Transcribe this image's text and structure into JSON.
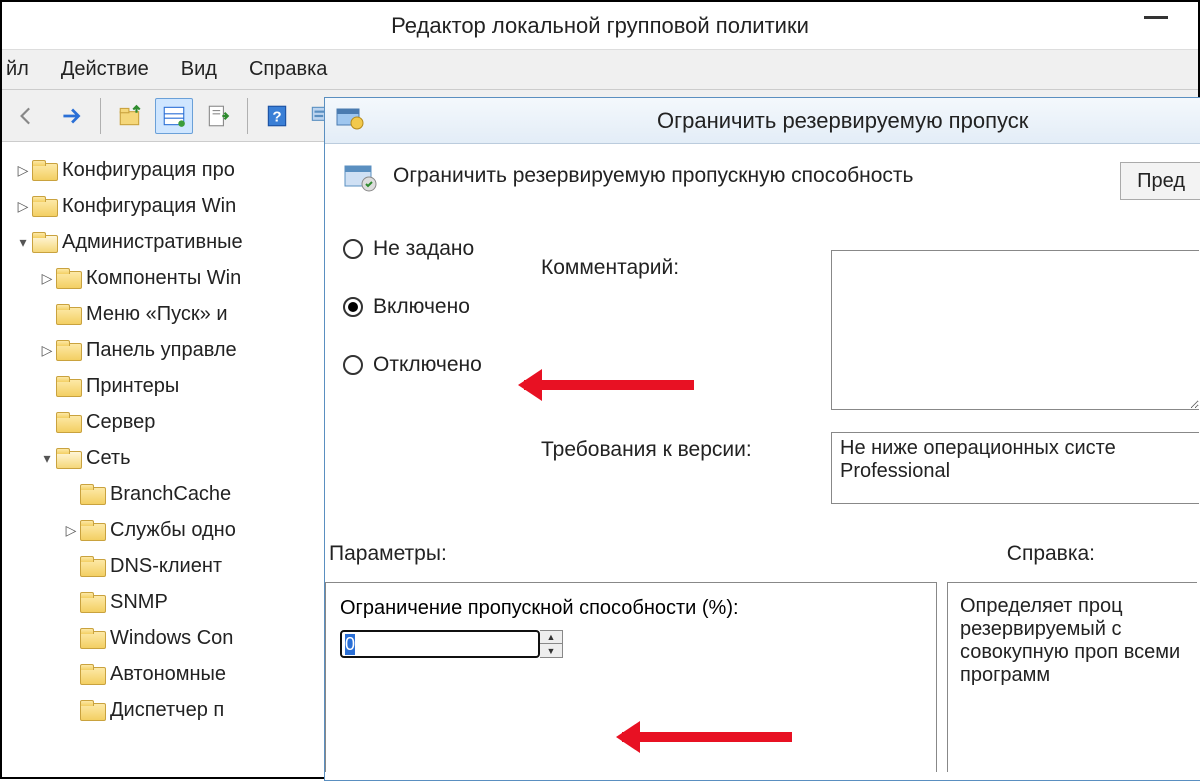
{
  "window": {
    "title": "Редактор локальной групповой политики"
  },
  "menu": {
    "file": "йл",
    "action": "Действие",
    "view": "Вид",
    "help": "Справка"
  },
  "tree": {
    "items": [
      {
        "indent": 1,
        "caret": "right",
        "label": "Конфигурация про"
      },
      {
        "indent": 1,
        "caret": "right",
        "label": "Конфигурация Win"
      },
      {
        "indent": 1,
        "caret": "down",
        "label": "Административные"
      },
      {
        "indent": 2,
        "caret": "right",
        "label": "Компоненты Win"
      },
      {
        "indent": 2,
        "caret": "",
        "label": "Меню «Пуск» и"
      },
      {
        "indent": 2,
        "caret": "right",
        "label": "Панель управле"
      },
      {
        "indent": 2,
        "caret": "",
        "label": "Принтеры"
      },
      {
        "indent": 2,
        "caret": "",
        "label": "Сервер"
      },
      {
        "indent": 2,
        "caret": "down",
        "label": "Сеть"
      },
      {
        "indent": 3,
        "caret": "",
        "label": "BranchCache"
      },
      {
        "indent": 3,
        "caret": "right",
        "label": "Службы одно"
      },
      {
        "indent": 3,
        "caret": "",
        "label": "DNS-клиент"
      },
      {
        "indent": 3,
        "caret": "",
        "label": "SNMP"
      },
      {
        "indent": 3,
        "caret": "",
        "label": "Windows Con"
      },
      {
        "indent": 3,
        "caret": "",
        "label": "Автономные"
      },
      {
        "indent": 3,
        "caret": "",
        "label": "Диспетчер п"
      }
    ]
  },
  "dialog": {
    "title": "Ограничить резервируемую пропуск",
    "policy_title": "Ограничить резервируемую пропускную способность",
    "prev_button": "Пред",
    "radios": {
      "not_configured": "Не задано",
      "enabled": "Включено",
      "disabled": "Отключено"
    },
    "comment_label": "Комментарий:",
    "requirements_label": "Требования к версии:",
    "requirements_value": "Не ниже операционных систе Professional",
    "params_label": "Параметры:",
    "help_label": "Справка:",
    "bandwidth_label": "Ограничение пропускной способности (%):",
    "bandwidth_value": "0",
    "help_text": "Определяет проц резервируемый с совокупную проп всеми программ"
  }
}
